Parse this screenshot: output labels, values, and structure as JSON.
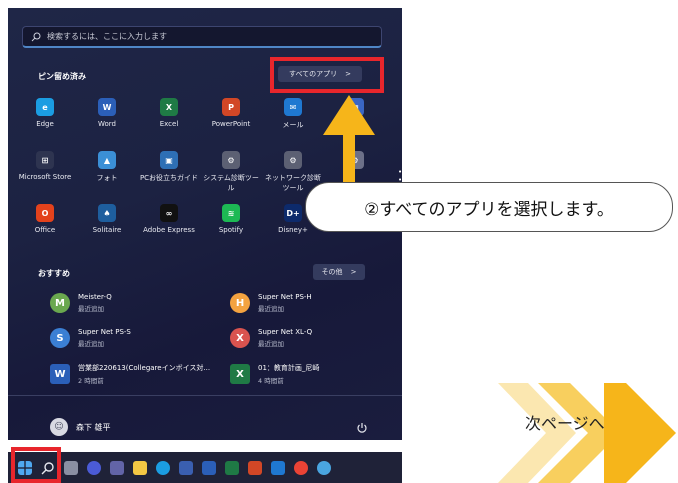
{
  "search": {
    "placeholder": "検索するには、ここに入力します"
  },
  "pinned": {
    "title": "ピン留め済み",
    "all_apps_button": "すべてのアプリ",
    "all_apps_chevron": ">",
    "apps": [
      {
        "label": "Edge",
        "icon": "edge-icon",
        "color": "#1b9de2",
        "glyph": "e"
      },
      {
        "label": "Word",
        "icon": "word-icon",
        "color": "#2b5fb8",
        "glyph": "W"
      },
      {
        "label": "Excel",
        "icon": "excel-icon",
        "color": "#1f7a45",
        "glyph": "X"
      },
      {
        "label": "PowerPoint",
        "icon": "powerpoint-icon",
        "color": "#d24726",
        "glyph": "P"
      },
      {
        "label": "メール",
        "icon": "mail-icon",
        "color": "#1f78d1",
        "glyph": "✉"
      },
      {
        "label": "",
        "icon": "calendar-icon",
        "color": "#3a66c4",
        "glyph": "▦"
      },
      {
        "label": "Microsoft Store",
        "icon": "store-icon",
        "color": "#2e3450",
        "glyph": "⊞"
      },
      {
        "label": "フォト",
        "icon": "photos-icon",
        "color": "#3b8fd6",
        "glyph": "▲"
      },
      {
        "label": "PCお役立ちガイド",
        "icon": "guide-icon",
        "color": "#2e6fb5",
        "glyph": "▣"
      },
      {
        "label": "システム診断ツール",
        "icon": "diagnostic-icon",
        "color": "#5c6073",
        "glyph": "⚙"
      },
      {
        "label": "ネットワーク診断\nツール",
        "icon": "network-tool-icon",
        "color": "#5c6073",
        "glyph": "⚙"
      },
      {
        "label": "",
        "icon": "settings-icon",
        "color": "#6c7088",
        "glyph": "⚙"
      },
      {
        "label": "Office",
        "icon": "office-icon",
        "color": "#e3421c",
        "glyph": "O"
      },
      {
        "label": "Solitaire",
        "icon": "solitaire-icon",
        "color": "#1e5e9e",
        "glyph": "♠"
      },
      {
        "label": "Adobe Express",
        "icon": "adobe-express-icon",
        "color": "#111111",
        "glyph": "∞"
      },
      {
        "label": "Spotify",
        "icon": "spotify-icon",
        "color": "#1db954",
        "glyph": "≋"
      },
      {
        "label": "Disney+",
        "icon": "disney-icon",
        "color": "#0d2a6b",
        "glyph": "D+"
      }
    ]
  },
  "recommended": {
    "title": "おすすめ",
    "more_button": "その他",
    "more_chevron": ">",
    "items": [
      {
        "name": "Meister-Q",
        "sub": "最近追加",
        "color": "#6aa84f",
        "glyph": "M"
      },
      {
        "name": "Super Net PS-H",
        "sub": "最近追加",
        "color": "#f4a340",
        "glyph": "H"
      },
      {
        "name": "Super Net PS-S",
        "sub": "最近追加",
        "color": "#3b7fd4",
        "glyph": "S"
      },
      {
        "name": "Super Net XL-Q",
        "sub": "最近追加",
        "color": "#d9534f",
        "glyph": "X"
      },
      {
        "name": "営業部220613(Collegareインボイス対...",
        "sub": "2 時間前",
        "color": "#2b5fb8",
        "glyph": "W"
      },
      {
        "name": "01：教育計画_尼崎",
        "sub": "4 時間前",
        "color": "#1f7a45",
        "glyph": "X"
      }
    ]
  },
  "user": {
    "name": "森下 雄平"
  },
  "callout": {
    "text": "②すべてのアプリを選択します。"
  },
  "next_page": {
    "label": "次ページへ"
  },
  "colors": {
    "highlight": "#e8262c",
    "arrow": "#f6b51a",
    "next_arrow": "#f6b51a"
  }
}
